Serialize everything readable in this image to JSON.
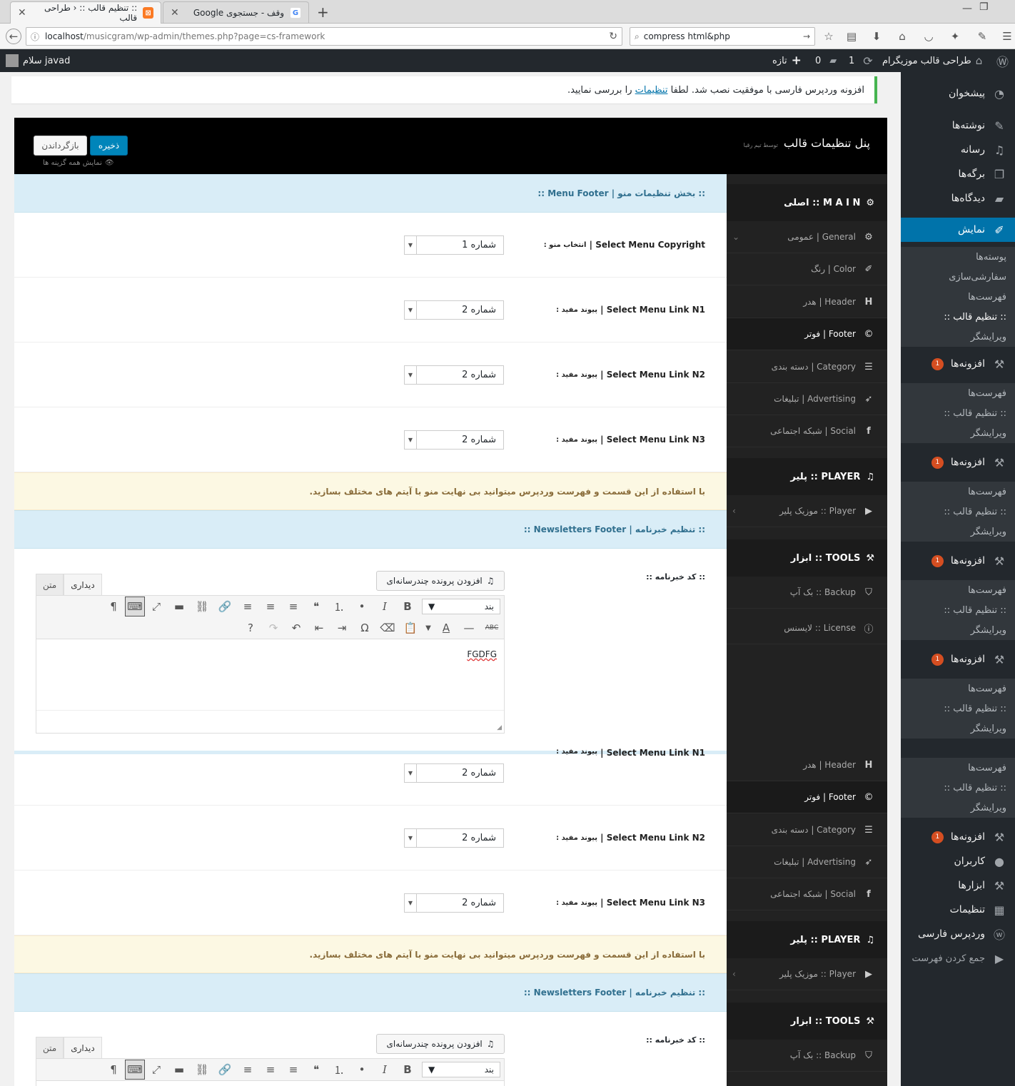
{
  "browser": {
    "tabs": [
      {
        "title": ":: تنظیم قالب :: ‹ طراحی قالب",
        "active": true,
        "favicon": "xampp-icon"
      },
      {
        "title": "وقف - جستجوی Google",
        "active": false,
        "favicon": "google-icon"
      }
    ],
    "url_host": "localhost",
    "url_path": "/musicgram/wp-admin/themes.php?page=cs-framework",
    "search_value": "compress html&php"
  },
  "adminbar": {
    "greeting": "سلام javad",
    "site_name": "طراحی قالب موزیگرام",
    "updates": "1",
    "comments": "0",
    "new_label": "تازه"
  },
  "menu": {
    "dashboard": "پیشخوان",
    "posts": "نوشته‌ها",
    "media": "رسانه",
    "pages": "برگه‌ها",
    "comments": "دیدگاه‌ها",
    "appearance": "نمایش",
    "appearance_sub": [
      "پوسته‌ها",
      "سفارشی‌سازی",
      "فهرست‌ها",
      ":: تنظیم قالب ::",
      "ویرایشگر"
    ],
    "plugins": "افزونه‌ها",
    "plugins_badge": "1",
    "repeat_sub": [
      "فهرست‌ها",
      ":: تنظیم قالب ::",
      "ویرایشگر"
    ],
    "users": "کاربران",
    "tools": "ابزارها",
    "settings": "تنظیمات",
    "wp_farsi": "وردپرس فارسی",
    "collapse": "جمع کردن فهرست"
  },
  "notice": {
    "text_before": "افزونه وردپرس فارسی با موفقیت نصب شد. لطفا",
    "link": "تنظیمات",
    "text_after": "را بررسی نمایید."
  },
  "panel": {
    "title": "پنل تنظیمات قالب",
    "by": "توسط تیم رقبا",
    "save": "ذخیره",
    "reset": "بازگرداندن",
    "show_all": "نمایش همه گزینه ها"
  },
  "nav": {
    "main": "M A I N :: اصلی",
    "general": "General | عمومی",
    "color": "Color | رنگ",
    "header": "Header | هدر",
    "footer": "Footer | فوتر",
    "category": "Category | دسته بندی",
    "advertising": "Advertising | تبلیغات",
    "social": "Social | شبکه اجتماعی",
    "player_sec": "PLAYER :: پلیر",
    "player": "Player :: موزیک پلیر",
    "tools_sec": "TOOLS :: ابزار",
    "backup": "Backup :: بک آپ",
    "license": "License :: لایسنس"
  },
  "content": {
    "menu_footer_title": ":: بخش تنظیمات منو | Menu Footer ::",
    "copyright_label": "Select Menu Copyright |",
    "copyright_small": "انتخاب منو :",
    "copyright_value": "شماره 1",
    "link_n1": "Select Menu Link N1 |",
    "link_n2": "Select Menu Link N2 |",
    "link_n3": "Select Menu Link N3 |",
    "link_small": "پیوند مفید :",
    "link_value": "شماره 2",
    "info_notice": "با استفاده از این قسمت و فهرست وردپرس میتوانید بی نهایت منو با آیتم های مختلف بسازید.",
    "newsletter_title": ":: تنظیم خبرنامه | Newsletters Footer ::",
    "newsletter_label": ":: کد خبرنامه ::",
    "add_media": "افزودن پرونده چندرسانه‌ای",
    "tab_visual": "دیداری",
    "tab_text": "متن",
    "format_value": "بند",
    "editor_text": "FGDFG"
  }
}
